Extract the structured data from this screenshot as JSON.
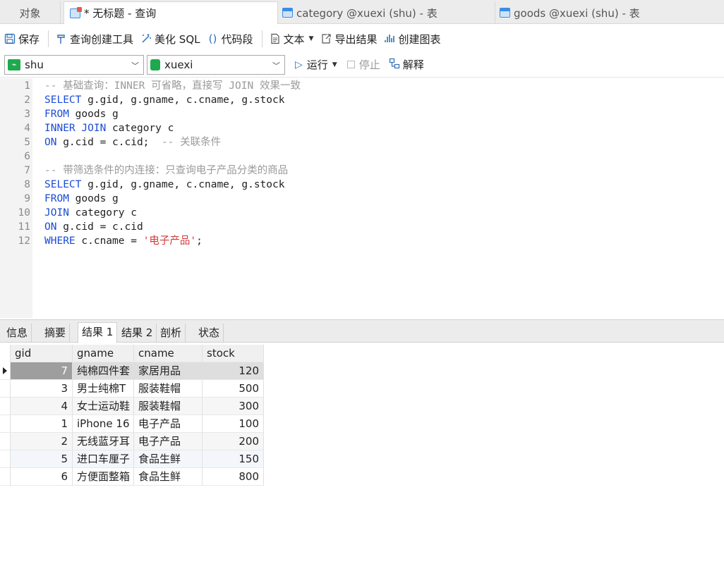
{
  "tabs": [
    {
      "label": "对象",
      "icon": ""
    },
    {
      "label": "* 无标题 - 查询",
      "icon": "query-icon"
    },
    {
      "label": "category @xuexi (shu) - 表",
      "icon": "table-icon"
    },
    {
      "label": "goods @xuexi (shu) - 表",
      "icon": "table-icon"
    }
  ],
  "toolbar": {
    "save": "保存",
    "query_builder": "查询创建工具",
    "beautify": "美化 SQL",
    "snippet": "代码段",
    "text": "文本",
    "export": "导出结果",
    "create_chart": "创建图表"
  },
  "toolbar2": {
    "connection": "shu",
    "database": "xuexi",
    "run": "运行",
    "stop": "停止",
    "explain": "解释"
  },
  "editor": {
    "line_numbers": [
      "1",
      "2",
      "3",
      "4",
      "5",
      "6",
      "7",
      "8",
      "9",
      "10",
      "11",
      "12"
    ],
    "lines": [
      [
        {
          "t": "cm",
          "v": "-- 基础查询：INNER 可省略，直接写 JOIN 效果一致"
        }
      ],
      [
        {
          "t": "kw",
          "v": "SELECT"
        },
        {
          "t": "tx",
          "v": " g.gid, g.gname, c.cname, g.stock"
        }
      ],
      [
        {
          "t": "kw",
          "v": "FROM"
        },
        {
          "t": "tx",
          "v": " goods g"
        }
      ],
      [
        {
          "t": "kw",
          "v": "INNER JOIN"
        },
        {
          "t": "tx",
          "v": " category c"
        }
      ],
      [
        {
          "t": "kw",
          "v": "ON"
        },
        {
          "t": "tx",
          "v": " g.cid = c.cid;  "
        },
        {
          "t": "cm",
          "v": "-- 关联条件"
        }
      ],
      [],
      [
        {
          "t": "cm",
          "v": "-- 带筛选条件的内连接：只查询电子产品分类的商品"
        }
      ],
      [
        {
          "t": "kw",
          "v": "SELECT"
        },
        {
          "t": "tx",
          "v": " g.gid, g.gname, c.cname, g.stock"
        }
      ],
      [
        {
          "t": "kw",
          "v": "FROM"
        },
        {
          "t": "tx",
          "v": " goods g"
        }
      ],
      [
        {
          "t": "kw",
          "v": "JOIN"
        },
        {
          "t": "tx",
          "v": " category c"
        }
      ],
      [
        {
          "t": "kw",
          "v": "ON"
        },
        {
          "t": "tx",
          "v": " g.cid = c.cid"
        }
      ],
      [
        {
          "t": "kw",
          "v": "WHERE"
        },
        {
          "t": "tx",
          "v": " c.cname = "
        },
        {
          "t": "st",
          "v": "'电子产品'"
        },
        {
          "t": "tx",
          "v": ";"
        }
      ]
    ]
  },
  "result_tabs": [
    "信息",
    "摘要",
    "结果 1",
    "结果 2",
    "剖析",
    "状态"
  ],
  "active_result_tab": 2,
  "result": {
    "columns": [
      "gid",
      "gname",
      "cname",
      "stock"
    ],
    "rows": [
      [
        "7",
        "纯棉四件套",
        "家居用品",
        "120"
      ],
      [
        "3",
        "男士纯棉T",
        "服装鞋帽",
        "500"
      ],
      [
        "4",
        "女士运动鞋",
        "服装鞋帽",
        "300"
      ],
      [
        "1",
        "iPhone 16",
        "电子产品",
        "100"
      ],
      [
        "2",
        "无线蓝牙耳",
        "电子产品",
        "200"
      ],
      [
        "5",
        "进口车厘子",
        "食品生鲜",
        "150"
      ],
      [
        "6",
        "方便面整箱",
        "食品生鲜",
        "800"
      ]
    ]
  }
}
